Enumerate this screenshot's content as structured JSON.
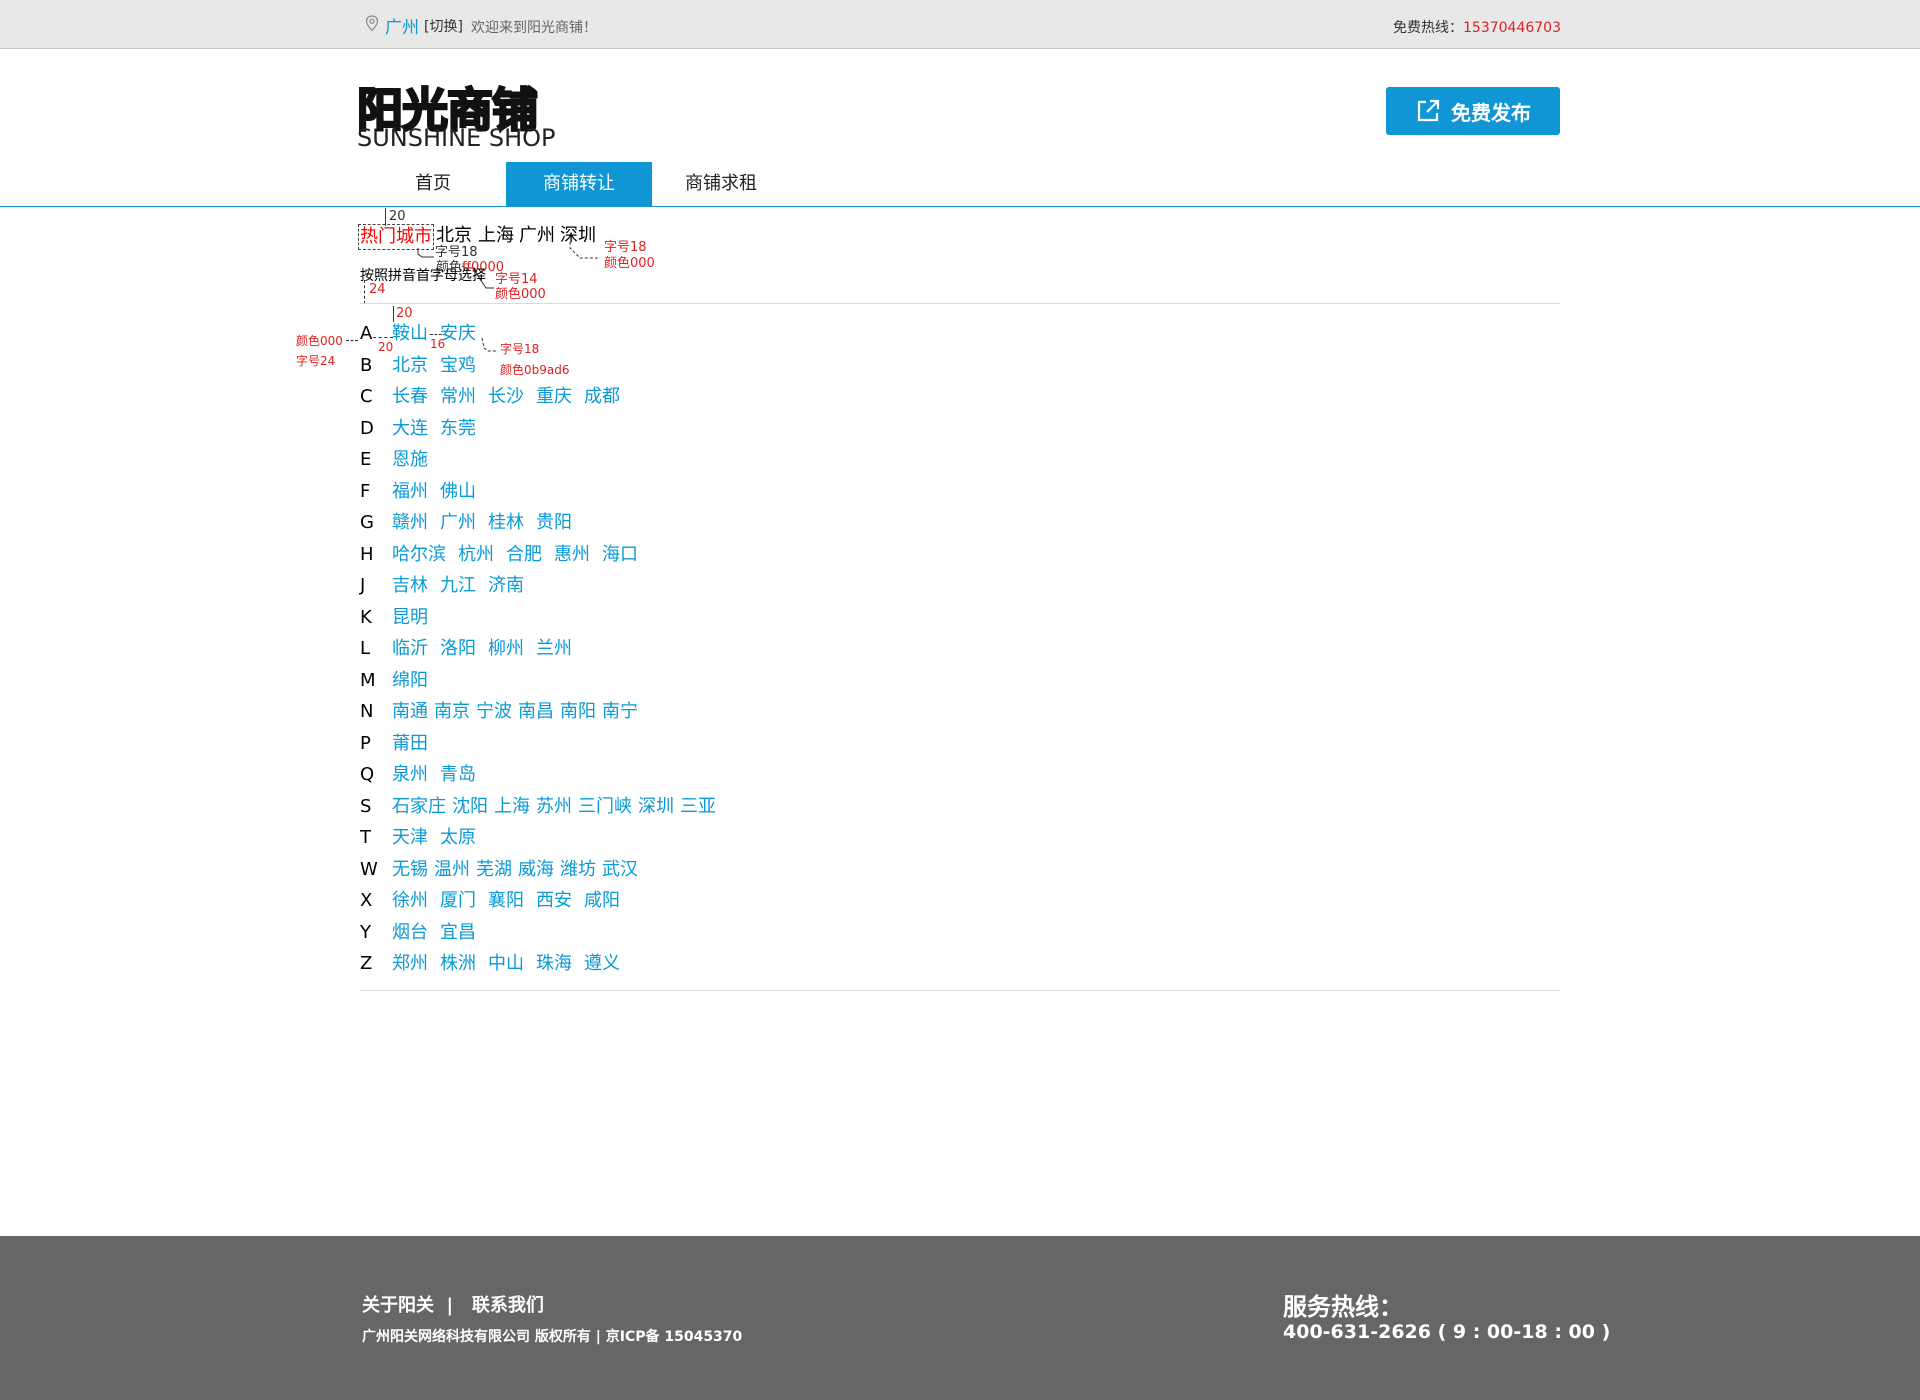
{
  "topbar": {
    "city": "广州",
    "switch_label": "[切换]",
    "welcome": "欢迎来到阳光商铺！",
    "hotline_label": "免费热线：",
    "hotline_number": "15370446703"
  },
  "header": {
    "logo_cn": "阳光商铺",
    "logo_en": "SUNSHINE SHOP",
    "publish_label": "免费发布"
  },
  "nav": {
    "items": [
      {
        "label": "首页"
      },
      {
        "label": "商铺转让"
      },
      {
        "label": "商铺求租"
      }
    ],
    "active": "商铺转让"
  },
  "hot": {
    "label": "热门城市",
    "cities": [
      "北京",
      "上海",
      "广州",
      "深圳"
    ],
    "sort_hint": "按照拼音首字母选择"
  },
  "letters": [
    {
      "letter": "A",
      "cities": [
        "鞍山",
        "安庆"
      ]
    },
    {
      "letter": "B",
      "cities": [
        "北京",
        "宝鸡"
      ]
    },
    {
      "letter": "C",
      "cities": [
        "长春",
        "常州",
        "长沙",
        "重庆",
        "成都"
      ]
    },
    {
      "letter": "D",
      "cities": [
        "大连",
        "东莞"
      ]
    },
    {
      "letter": "E",
      "cities": [
        "恩施"
      ]
    },
    {
      "letter": "F",
      "cities": [
        "福州",
        "佛山"
      ]
    },
    {
      "letter": "G",
      "cities": [
        "赣州",
        "广州",
        "桂林",
        "贵阳"
      ]
    },
    {
      "letter": "H",
      "cities": [
        "哈尔滨",
        "杭州",
        "合肥",
        "惠州",
        "海口"
      ]
    },
    {
      "letter": "J",
      "cities": [
        "吉林",
        "九江",
        "济南"
      ]
    },
    {
      "letter": "K",
      "cities": [
        "昆明"
      ]
    },
    {
      "letter": "L",
      "cities": [
        "临沂",
        "洛阳",
        "柳州",
        "兰州"
      ]
    },
    {
      "letter": "M",
      "cities": [
        "绵阳"
      ]
    },
    {
      "letter": "N",
      "cities": [
        "南通",
        "南京",
        "宁波",
        "南昌",
        "南阳",
        "南宁"
      ]
    },
    {
      "letter": "P",
      "cities": [
        "莆田"
      ]
    },
    {
      "letter": "Q",
      "cities": [
        "泉州",
        "青岛"
      ]
    },
    {
      "letter": "S",
      "cities": [
        "石家庄",
        "沈阳",
        "上海",
        "苏州",
        "三门峡",
        "深圳",
        "三亚"
      ]
    },
    {
      "letter": "T",
      "cities": [
        "天津",
        "太原"
      ]
    },
    {
      "letter": "W",
      "cities": [
        "无锡",
        "温州",
        "芜湖",
        "威海",
        "潍坊",
        "武汉"
      ]
    },
    {
      "letter": "X",
      "cities": [
        "徐州",
        "厦门",
        "襄阳",
        "西安",
        "咸阳"
      ]
    },
    {
      "letter": "Y",
      "cities": [
        "烟台",
        "宜昌"
      ]
    },
    {
      "letter": "Z",
      "cities": [
        "郑州",
        "株洲",
        "中山",
        "珠海",
        "遵义"
      ]
    }
  ],
  "annotations": {
    "gap_top": "20",
    "hot_size": "字号18",
    "hot_color": "颜色ff0000",
    "city_size": "字号18",
    "city_color": "颜色000",
    "hint_size": "字号14",
    "hint_color": "颜色000",
    "hint_gap": "24",
    "list_gap": "20",
    "letter_color": "颜色000",
    "letter_size": "字号24",
    "letter_gap": "20",
    "city_gap": "16",
    "link_size": "字号18",
    "link_color": "颜色0b9ad6"
  },
  "footer": {
    "links": "关于阳关  |   联系我们",
    "copyright": "广州阳关网络科技有限公司 版权所有 | 京ICP备 15045370",
    "service_title": "服务热线：",
    "service_number": "400-631-2626 ( 9 : 00-18 : 00 )"
  },
  "colors": {
    "accent": "#1196d5",
    "link": "#0b9ad6",
    "hot_label": "#ff0000",
    "footer_bg": "#666666"
  }
}
